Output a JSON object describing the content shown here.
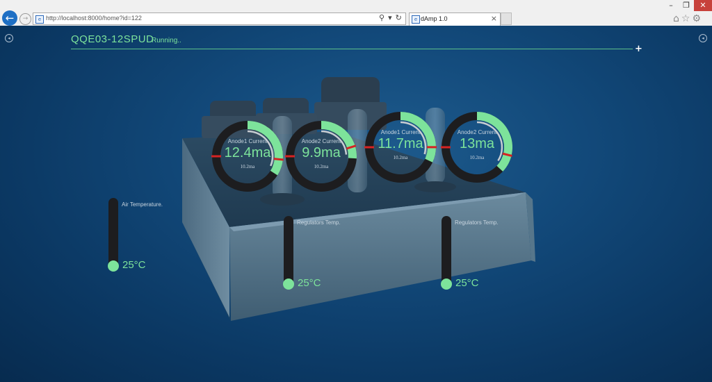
{
  "browser": {
    "url": "http://localhost:8000/home?id=122",
    "tab_title": "dAmp 1.0",
    "tab_close": "×",
    "back_glyph": "←",
    "search_glyph": "⚲",
    "dropdown_glyph": "▾",
    "refresh_glyph": "↻",
    "home_glyph": "⌂",
    "favorites_glyph": "☆",
    "settings_glyph": "⚙",
    "win_min": "–",
    "win_max": "❐",
    "win_close": "✕"
  },
  "app": {
    "title": "QQE03-12SPUD",
    "status": "Running..",
    "add_glyph": "+",
    "accent_color": "#7de39b"
  },
  "gauges": [
    {
      "label": "Anode1 Current",
      "value": "12.4ma",
      "sub": "10.2ma",
      "fill": 0.34,
      "marker": 0.75
    },
    {
      "label": "Anode2 Current",
      "value": "9.9ma",
      "sub": "10.2ma",
      "fill": 0.26,
      "marker": 0.75
    },
    {
      "label": "Anode1 Current",
      "value": "11.7ma",
      "sub": "10.2ma",
      "fill": 0.32,
      "marker": 0.75
    },
    {
      "label": "Anode2 Current",
      "value": "13ma",
      "sub": "10.2ma",
      "fill": 0.37,
      "marker": 0.75
    }
  ],
  "thermometers": [
    {
      "label": "Air Temperature.",
      "value": "25°C"
    },
    {
      "label": "Regulators Temp.",
      "value": "25°C"
    },
    {
      "label": "Regulators Temp.",
      "value": "25°C"
    }
  ]
}
